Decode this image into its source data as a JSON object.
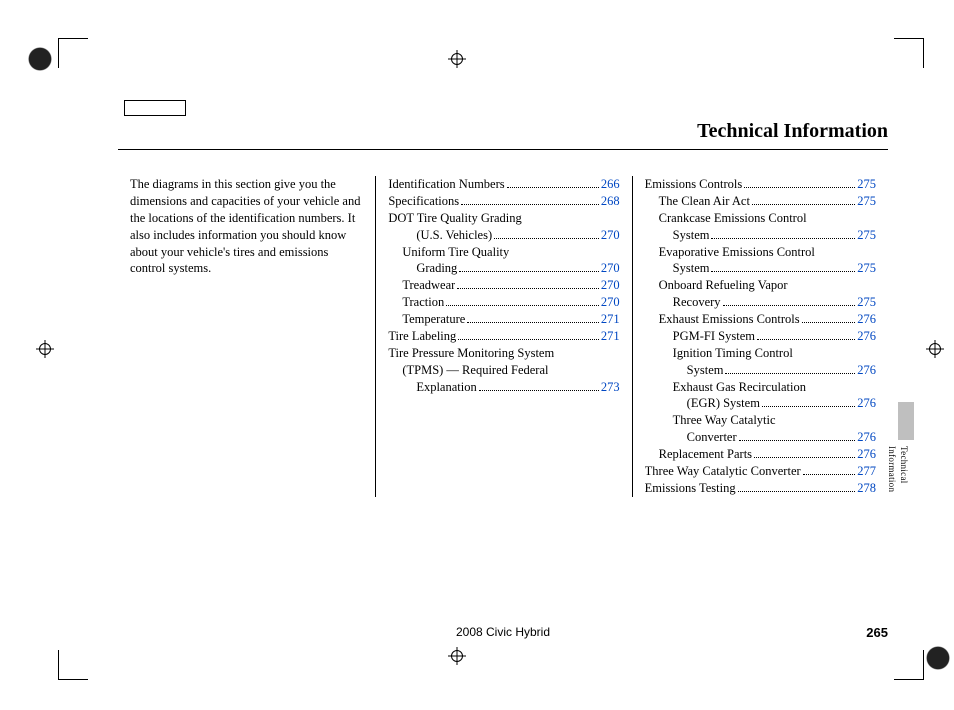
{
  "title": "Technical Information",
  "intro": "The diagrams in this section give you the dimensions and capacities of your vehicle and the locations of the identification numbers. It also includes information you should know about your vehicle's tires and emissions control systems.",
  "col2": [
    {
      "label": "Identification Numbers",
      "page": "266",
      "indent": 0
    },
    {
      "label": "Specifications",
      "page": "268",
      "indent": 0
    },
    {
      "label": "DOT Tire Quality Grading",
      "page": null,
      "indent": 0
    },
    {
      "label": "(U.S. Vehicles)",
      "page": "270",
      "indent": 2,
      "cont": true
    },
    {
      "label": "Uniform Tire Quality",
      "page": null,
      "indent": 1
    },
    {
      "label": "Grading",
      "page": "270",
      "indent": 2,
      "cont": true
    },
    {
      "label": "Treadwear",
      "page": "270",
      "indent": 1
    },
    {
      "label": "Traction",
      "page": "270",
      "indent": 1
    },
    {
      "label": "Temperature",
      "page": "271",
      "indent": 1
    },
    {
      "label": "Tire Labeling",
      "page": "271",
      "indent": 0
    },
    {
      "label": "Tire Pressure Monitoring System",
      "page": null,
      "indent": 0
    },
    {
      "label": "(TPMS) — Required Federal",
      "page": null,
      "indent": 1,
      "cont": true
    },
    {
      "label": "Explanation",
      "page": "273",
      "indent": 2,
      "cont": true
    }
  ],
  "col3": [
    {
      "label": "Emissions Controls",
      "page": "275",
      "indent": 0
    },
    {
      "label": "The Clean Air Act",
      "page": "275",
      "indent": 1
    },
    {
      "label": "Crankcase Emissions Control",
      "page": null,
      "indent": 1
    },
    {
      "label": "System",
      "page": "275",
      "indent": 2,
      "cont": true
    },
    {
      "label": "Evaporative Emissions Control",
      "page": null,
      "indent": 1
    },
    {
      "label": "System",
      "page": "275",
      "indent": 2,
      "cont": true
    },
    {
      "label": "Onboard Refueling Vapor",
      "page": null,
      "indent": 1
    },
    {
      "label": "Recovery",
      "page": "275",
      "indent": 2,
      "cont": true
    },
    {
      "label": "Exhaust Emissions Controls",
      "page": "276",
      "indent": 1
    },
    {
      "label": "PGM-FI System",
      "page": "276",
      "indent": 2
    },
    {
      "label": "Ignition Timing Control",
      "page": null,
      "indent": 2
    },
    {
      "label": "System",
      "page": "276",
      "indent": 3,
      "cont": true
    },
    {
      "label": "Exhaust Gas Recirculation",
      "page": null,
      "indent": 2
    },
    {
      "label": "(EGR) System",
      "page": "276",
      "indent": 3,
      "cont": true
    },
    {
      "label": "Three Way Catalytic",
      "page": null,
      "indent": 2
    },
    {
      "label": "Converter",
      "page": "276",
      "indent": 3,
      "cont": true
    },
    {
      "label": "Replacement Parts",
      "page": "276",
      "indent": 1
    },
    {
      "label": "Three Way Catalytic Converter",
      "page": "277",
      "indent": 0
    },
    {
      "label": "Emissions Testing",
      "page": "278",
      "indent": 0
    }
  ],
  "side_label": "Technical Information",
  "footer_model": "2008  Civic  Hybrid",
  "footer_page": "265"
}
